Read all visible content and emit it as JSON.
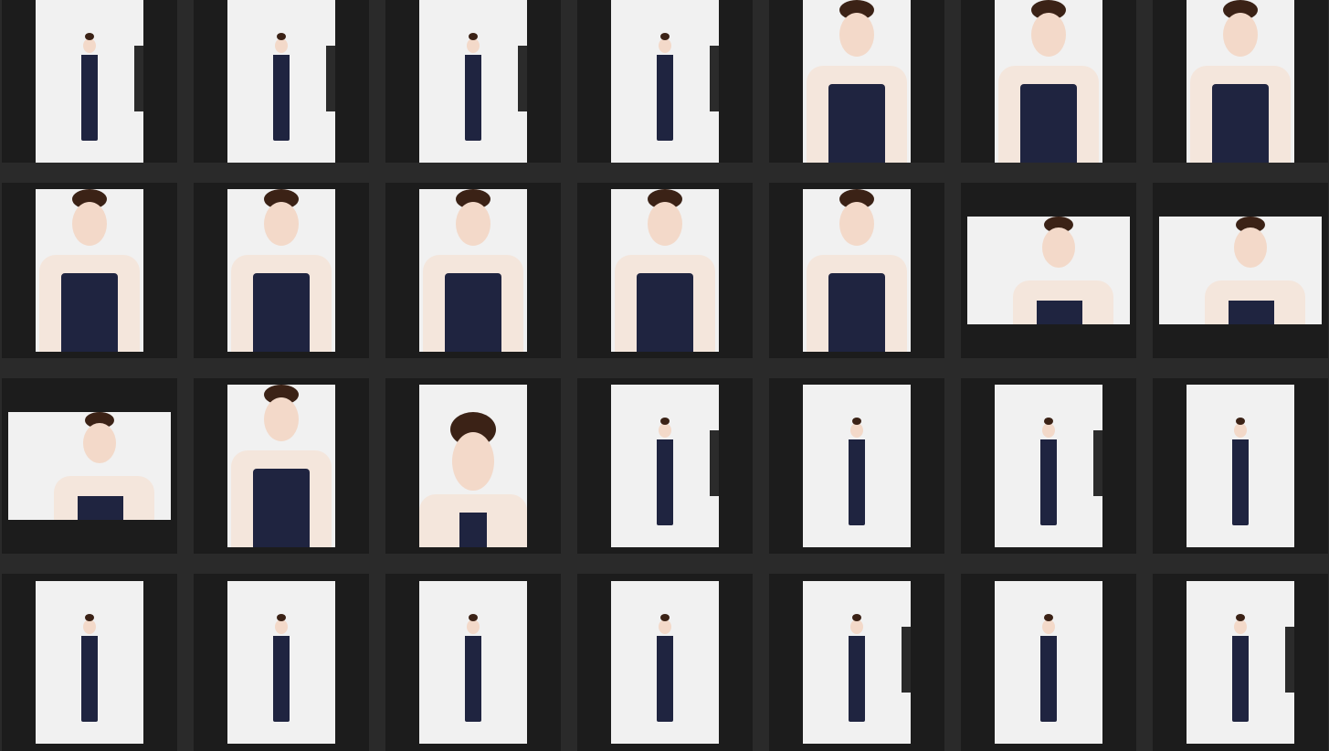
{
  "gallery": {
    "rows": [
      [
        "full",
        "full",
        "full",
        "full",
        "half",
        "half",
        "half"
      ],
      [
        "half",
        "half",
        "half",
        "half",
        "half",
        "land",
        "land"
      ],
      [
        "land",
        "half",
        "close",
        "full",
        "full",
        "full",
        "full"
      ],
      [
        "full",
        "full",
        "full",
        "full",
        "full",
        "full",
        "full"
      ]
    ]
  },
  "colors": {
    "background": "#2a2a2a",
    "cell": "#1c1c1c",
    "photo_bg": "#f1f1f1",
    "outfit": "#1f2440",
    "lace": "#f4e6dc"
  }
}
